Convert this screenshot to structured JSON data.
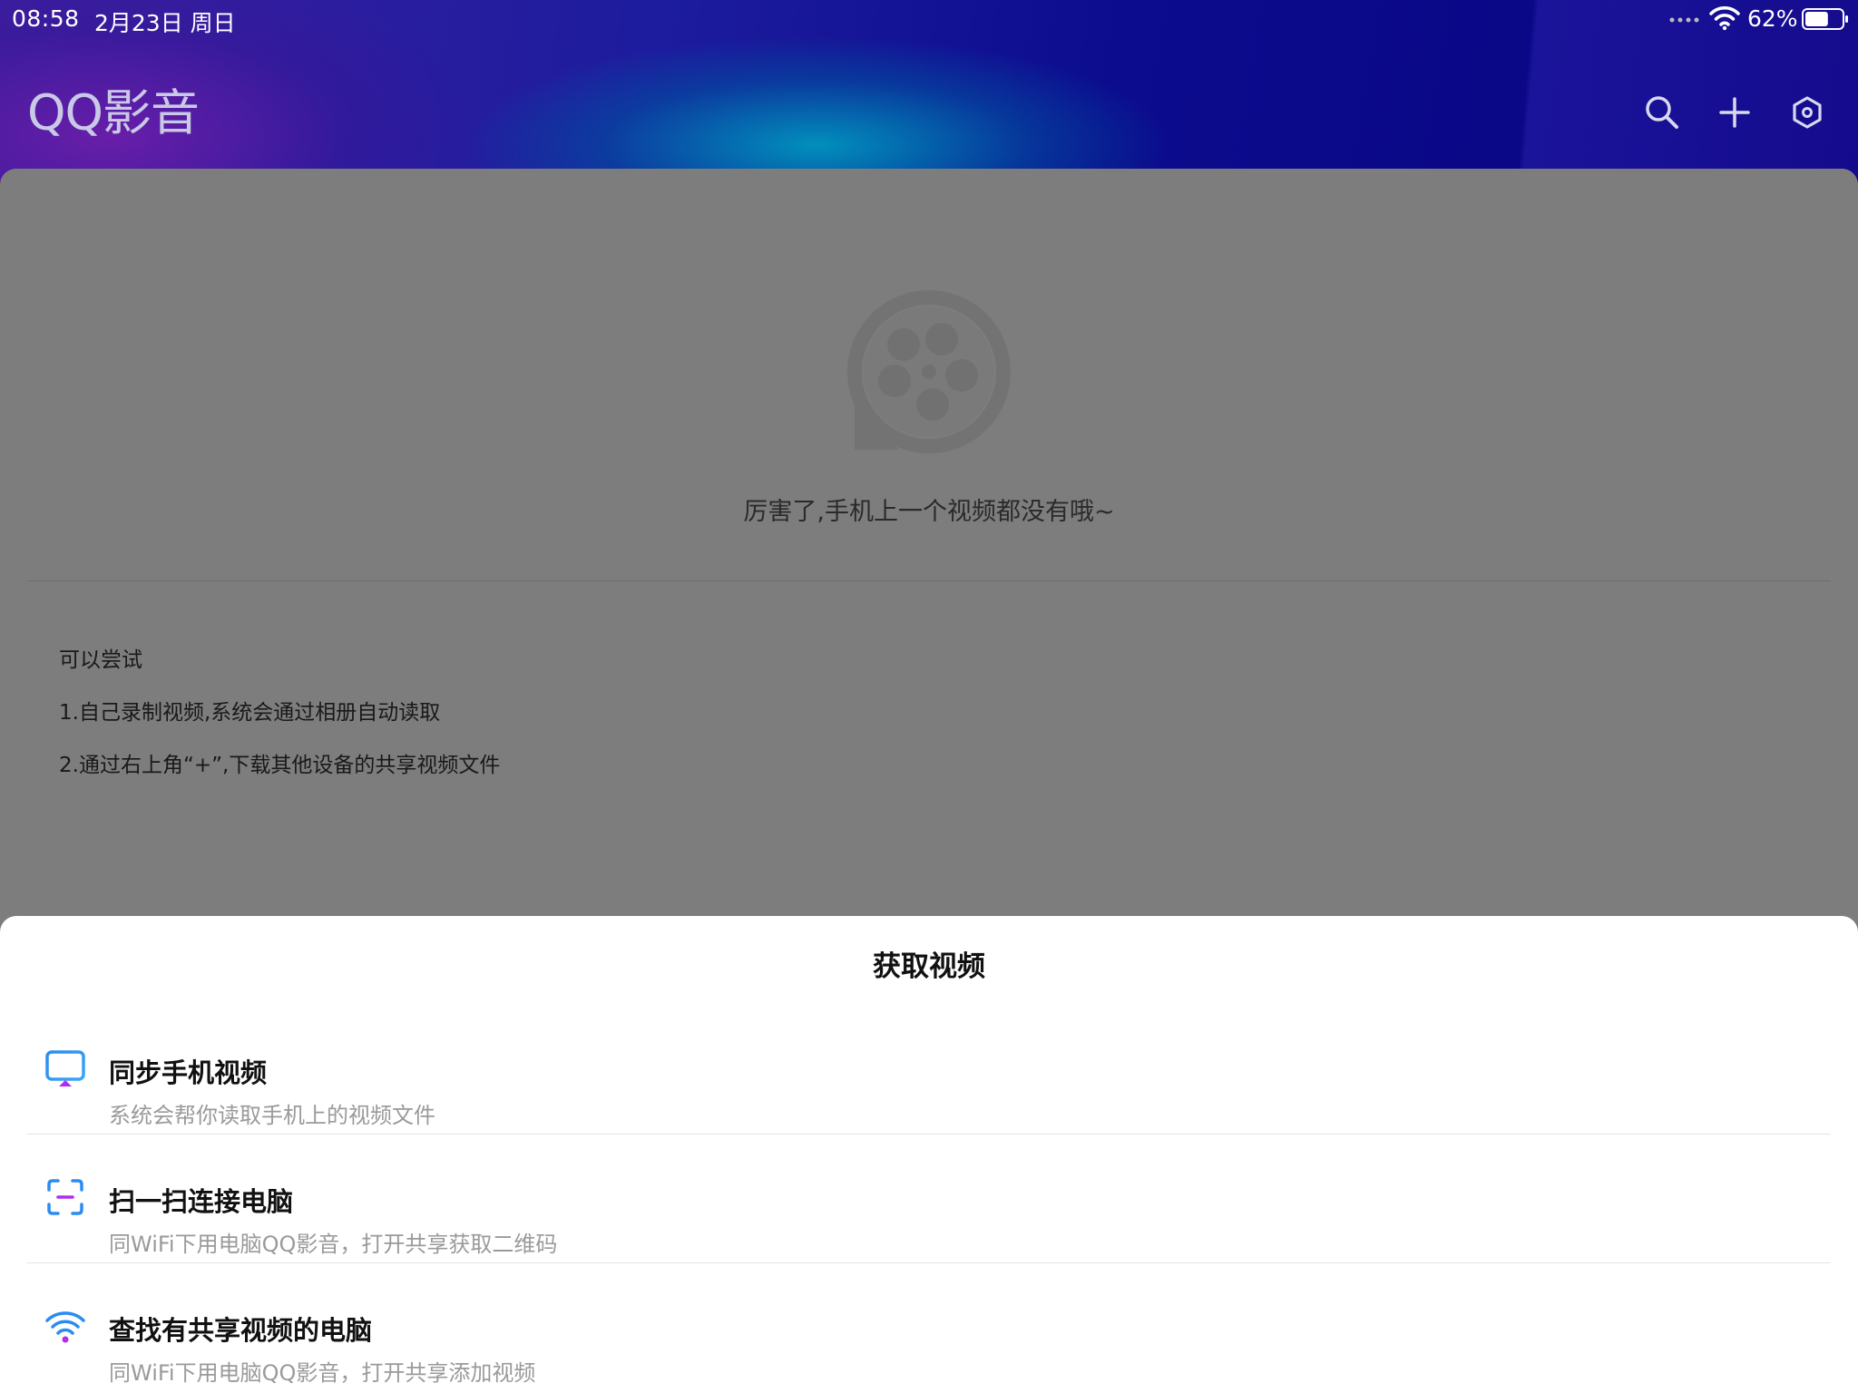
{
  "status_bar": {
    "time": "08:58",
    "date": "2月23日 周日",
    "battery_percent": "62%",
    "battery_level": 0.62
  },
  "app_bar": {
    "title": "QQ影音",
    "actions": [
      "search-icon",
      "plus-icon",
      "settings-hexagon-icon"
    ]
  },
  "empty_state": {
    "icon": "qq-video-reel-icon",
    "message": "厉害了,手机上一个视频都没有哦~"
  },
  "tips": {
    "heading": "可以尝试",
    "items": [
      "1.自己录制视频,系统会通过相册自动读取",
      "2.通过右上角“+”,下载其他设备的共享视频文件"
    ]
  },
  "sheet": {
    "title": "获取视频",
    "options": [
      {
        "icon": "screen-sync-icon",
        "title": "同步手机视频",
        "subtitle": "系统会帮你读取手机上的视频文件"
      },
      {
        "icon": "scan-icon",
        "title": "扫一扫连接电脑",
        "subtitle": "同WiFi下用电脑QQ影音，打开共享获取二维码"
      },
      {
        "icon": "wifi-icon",
        "title": "查找有共享视频的电脑",
        "subtitle": "同WiFi下用电脑QQ影音，打开共享添加视频"
      }
    ]
  },
  "colors": {
    "accent_blue": "#2b8cf0",
    "accent_purple": "#b12cf0"
  }
}
